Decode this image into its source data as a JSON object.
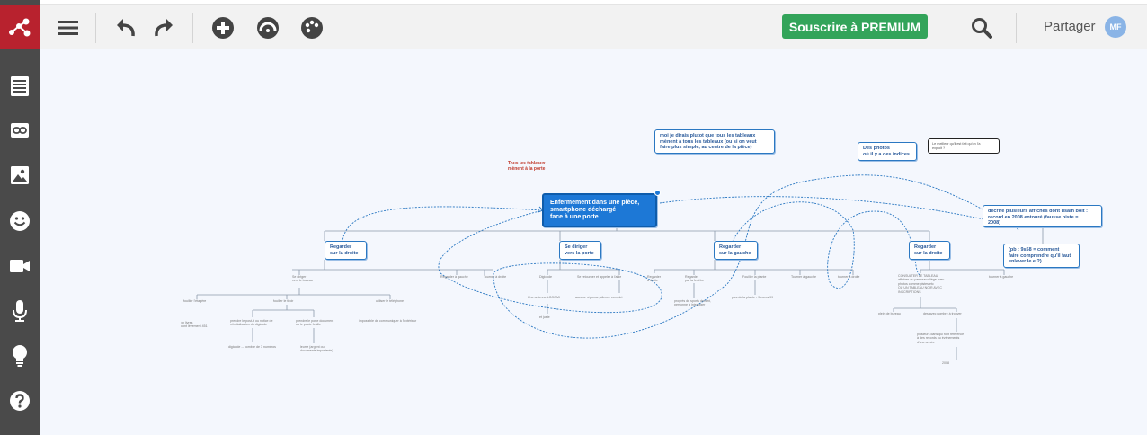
{
  "toolbar": {
    "menu_icon": "hamburger-menu-icon",
    "undo_icon": "undo-icon",
    "redo_icon": "redo-icon",
    "add_icon": "add-circle-icon",
    "style_icon": "gauge-icon",
    "palette_icon": "palette-icon",
    "premium_label": "Souscrire à PREMIUM",
    "search_icon": "search-icon",
    "share_label": "Partager",
    "avatar_initials": "MF"
  },
  "sidebar": {
    "logo_icon": "app-logo-icon",
    "items": [
      {
        "icon": "notes-icon"
      },
      {
        "icon": "link-icon"
      },
      {
        "icon": "image-icon"
      },
      {
        "icon": "smiley-icon"
      },
      {
        "icon": "video-icon"
      },
      {
        "icon": "microphone-icon"
      },
      {
        "icon": "lightbulb-icon"
      },
      {
        "icon": "help-icon"
      }
    ]
  },
  "colors": {
    "brand_red": "#b8222e",
    "sidebar": "#4a4a4a",
    "premium_green": "#33a45a",
    "node_blue": "#1d78d6",
    "link_blue": "#2b78c2"
  },
  "map": {
    "central": "Enfermement dans une pièce,\nsmartphone déchargé\nface à une porte",
    "red_label": "Tous les tableaux\nmènent à la porte",
    "comment_1": "moi je dirais plutot que tous les tableaux\nmènent à tous les tableaux (ou si on veut\nfaire plus simple, au centre de la pièce)",
    "comment_photos": "Des photos\noù il y a des indices",
    "comment_small": "Le meilleur qu'il est fait qu'on l'a\nexploit ?",
    "comment_poster": "décrire plusieurs affiches dont usain bolt :\nrecord en 2008 entouré (fausse piste =\n2008)",
    "comment_pb": "(pb : 9s58 = comment\nfaire comprendre qu'il faut\nenlever le e ?)",
    "branches": [
      "Regarder\nsur la droite",
      "Se diriger\nvers la porte",
      "Regarder\nsur la gauche",
      "Regarder\nsur la droite"
    ],
    "leaves": [
      "Se diriger\nvers le bureau",
      "Regarder à gauche",
      "Tourner à droite",
      "fouiller l'étagère",
      "fouiller le tiroir",
      "utiliser le téléphone",
      "4p livres\ndont lèvement 451",
      "prendre le post-it ou notice de\nréinitialisation du digicode",
      "prendre le porte document\nou le poste feuille",
      "impossible de communiquer à l'extérieur",
      "digicode -- nombre de 3 numéros",
      "leurre (argent ou\ndocuments importants)",
      "Digicode",
      "Se retourner et appeler à l'aide",
      "Une antenne LOOOMI",
      "aucune réponse, silence complet",
      "et juste",
      "Regarder\nà droite",
      "Regarder\npar la fenêtre",
      "Fouiller la plante",
      "Tourner à gauche",
      "tourner à droite",
      "progrès de sports devant,\npersonne à interroger",
      "pics de la plante - 9 euros 99",
      "CONSULTER LE TABLEAU\naffiches ou panneaux liège avec\nphotos comme pistes etc\nOU UN TABLEAU NOIR AVEC\nINSCRIPTIONS",
      "tourner à gauche",
      "plein de bureau",
      "des avec nombre à trouver",
      "plusieurs dans qui font référence\nà des records ou événements\nd'une année",
      "2008"
    ]
  }
}
